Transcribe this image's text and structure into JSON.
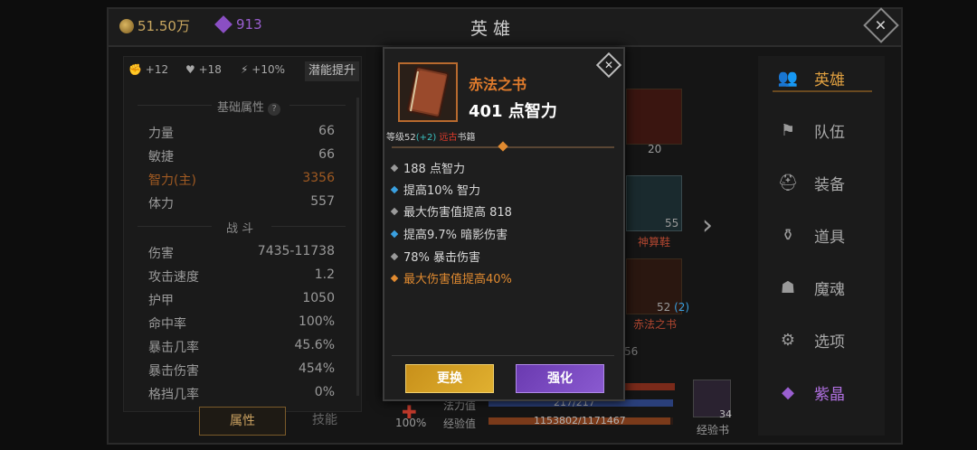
{
  "header": {
    "gold": "51.50万",
    "gems": "913",
    "title": "英雄"
  },
  "left": {
    "bonuses": [
      "+12",
      "+18",
      "+10%"
    ],
    "potential_button": "潜能提升",
    "basic_title": "基础属性",
    "help": "?",
    "basic_stats": [
      {
        "name": "力量",
        "value": "66"
      },
      {
        "name": "敏捷",
        "value": "66"
      },
      {
        "name": "智力(主)",
        "value": "3356"
      },
      {
        "name": "体力",
        "value": "557"
      }
    ],
    "combat_title": "战 斗",
    "combat_stats": [
      {
        "name": "伤害",
        "value": "7435-11738"
      },
      {
        "name": "攻击速度",
        "value": "1.2"
      },
      {
        "name": "护甲",
        "value": "1050"
      },
      {
        "name": "命中率",
        "value": "100%"
      },
      {
        "name": "暴击几率",
        "value": "45.6%"
      },
      {
        "name": "暴击伤害",
        "value": "454%"
      },
      {
        "name": "格挡几率",
        "value": "0%"
      }
    ],
    "tabs": [
      "属性",
      "技能"
    ]
  },
  "middle": {
    "slot1_count": "20",
    "slot2_count": "55",
    "slot2_label": "神算鞋",
    "slot3_count": "52",
    "slot3_bonus": "(2)",
    "slot3_label": "赤法之书",
    "partial_count": "56",
    "percent": "100%",
    "mana_label": "法力值",
    "mana_value": "217/217",
    "exp_label": "经验值",
    "exp_value": "1153802/1171467",
    "exp_fraction": 0.985,
    "expbook_count": "34",
    "expbook_label": "经验书"
  },
  "menu": [
    "英雄",
    "队伍",
    "装备",
    "道具",
    "魔魂",
    "选项",
    "紫晶"
  ],
  "popup": {
    "name": "赤法之书",
    "main_stat": "401 点智力",
    "level_prefix": "等级52",
    "level_bonus": "(+2)",
    "rarity": "远古",
    "type": "书籍",
    "attributes": [
      {
        "text": "188 点智力",
        "color": "#9a9a9a"
      },
      {
        "text": "提高10% 智力",
        "color": "#3aa0e0"
      },
      {
        "text": "最大伤害值提高 818",
        "color": "#9a9a9a"
      },
      {
        "text": "提高9.7% 暗影伤害",
        "color": "#3aa0e0"
      },
      {
        "text": "78% 暴击伤害",
        "color": "#9a9a9a"
      },
      {
        "text": "最大伤害值提高40%",
        "color": "#e08a30"
      }
    ],
    "btn_replace": "更换",
    "btn_upgrade": "强化"
  }
}
